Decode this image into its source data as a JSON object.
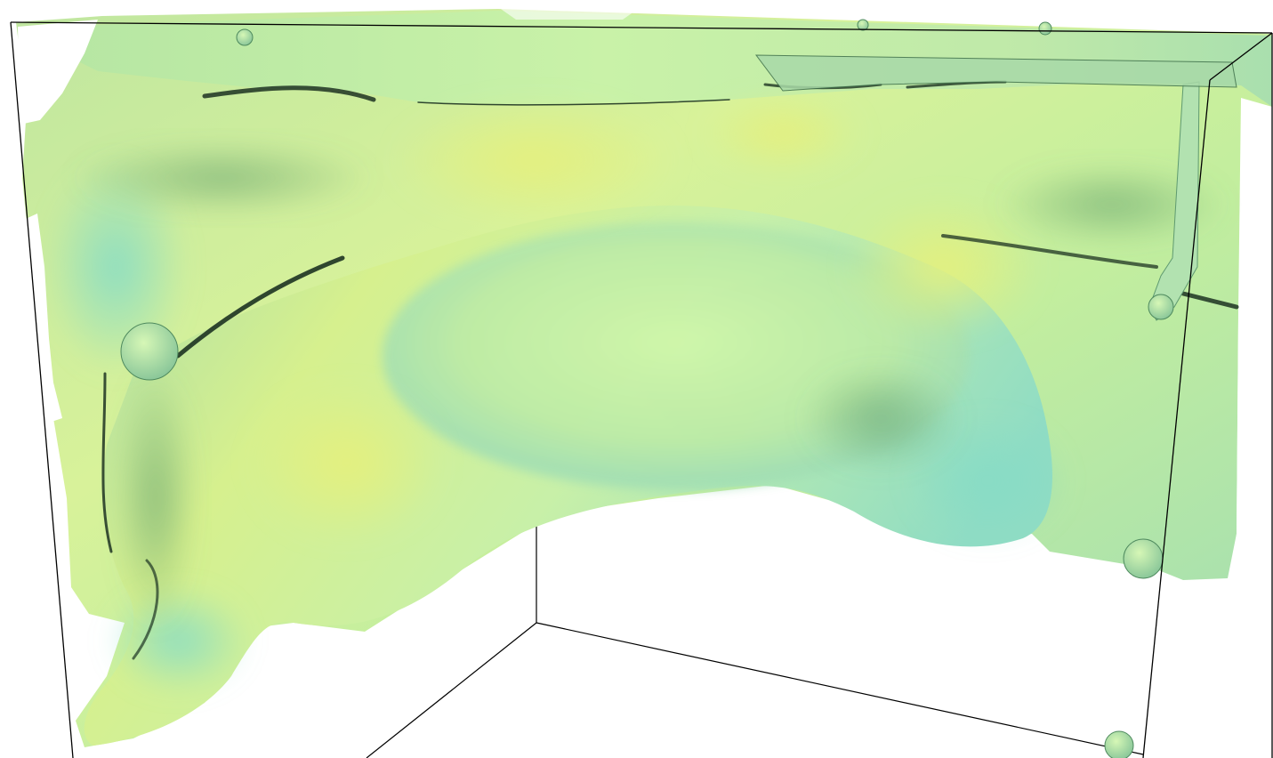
{
  "scene": {
    "subject": "fluid-interface-isosurface",
    "colors": {
      "background": "#ffffff",
      "surface_light": "#d2f5a4",
      "surface_yellow": "#dff08a",
      "surface_mid": "#b4e39a",
      "surface_teal": "#8fdcc0",
      "surface_shadow": "#4f8a5e",
      "crease": "#1d3322",
      "box_edge": "#000000"
    }
  }
}
